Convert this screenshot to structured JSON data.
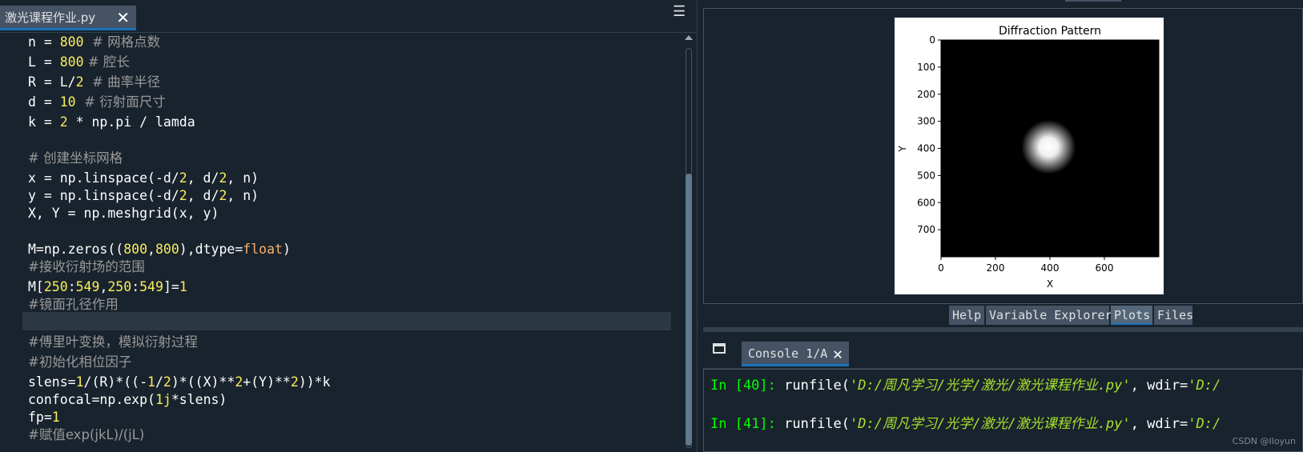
{
  "editor": {
    "tab_label": "激光课程作业.py",
    "close_glyph": "✕",
    "menu_glyph": "☰",
    "lines": [
      [
        {
          "t": "n = ",
          "c": ""
        },
        {
          "t": "800",
          "c": "num"
        },
        {
          "t": "  # ",
          "c": "cmt"
        },
        {
          "t": "网格点数",
          "c": "cmt"
        }
      ],
      [
        {
          "t": "L = ",
          "c": ""
        },
        {
          "t": "800",
          "c": "num"
        },
        {
          "t": " # ",
          "c": "cmt"
        },
        {
          "t": "腔长",
          "c": "cmt"
        }
      ],
      [
        {
          "t": "R = L/",
          "c": ""
        },
        {
          "t": "2",
          "c": "num"
        },
        {
          "t": "  # ",
          "c": "cmt"
        },
        {
          "t": "曲率半径",
          "c": "cmt"
        }
      ],
      [
        {
          "t": "d = ",
          "c": ""
        },
        {
          "t": "10",
          "c": "num"
        },
        {
          "t": "  # ",
          "c": "cmt"
        },
        {
          "t": "衍射面尺寸",
          "c": "cmt"
        }
      ],
      [
        {
          "t": "k = ",
          "c": ""
        },
        {
          "t": "2",
          "c": "num"
        },
        {
          "t": " * np.pi / lamda",
          "c": ""
        }
      ],
      [],
      [
        {
          "t": "# ",
          "c": "cmt"
        },
        {
          "t": "创建坐标网格",
          "c": "cmt"
        }
      ],
      [
        {
          "t": "x = np.linspace(-d/",
          "c": ""
        },
        {
          "t": "2",
          "c": "num"
        },
        {
          "t": ", d/",
          "c": ""
        },
        {
          "t": "2",
          "c": "num"
        },
        {
          "t": ", n)",
          "c": ""
        }
      ],
      [
        {
          "t": "y = np.linspace(-d/",
          "c": ""
        },
        {
          "t": "2",
          "c": "num"
        },
        {
          "t": ", d/",
          "c": ""
        },
        {
          "t": "2",
          "c": "num"
        },
        {
          "t": ", n)",
          "c": ""
        }
      ],
      [
        {
          "t": "X, Y = np.meshgrid(x, y)",
          "c": ""
        }
      ],
      [],
      [
        {
          "t": "M=np.zeros((",
          "c": ""
        },
        {
          "t": "800",
          "c": "num"
        },
        {
          "t": ",",
          "c": ""
        },
        {
          "t": "800",
          "c": "num"
        },
        {
          "t": "),dtype=",
          "c": ""
        },
        {
          "t": "float",
          "c": "kw"
        },
        {
          "t": ")",
          "c": ""
        }
      ],
      [
        {
          "t": "#",
          "c": "cmt"
        },
        {
          "t": "接收衍射场的范围",
          "c": "cmt"
        }
      ],
      [
        {
          "t": "M[",
          "c": ""
        },
        {
          "t": "250",
          "c": "num"
        },
        {
          "t": ":",
          "c": ""
        },
        {
          "t": "549",
          "c": "num"
        },
        {
          "t": ",",
          "c": ""
        },
        {
          "t": "250",
          "c": "num"
        },
        {
          "t": ":",
          "c": ""
        },
        {
          "t": "549",
          "c": "num"
        },
        {
          "t": "]=",
          "c": ""
        },
        {
          "t": "1",
          "c": "num"
        }
      ],
      [
        {
          "t": "#",
          "c": "cmt"
        },
        {
          "t": "镜面孔径作用",
          "c": "cmt"
        }
      ],
      [],
      [
        {
          "t": "#",
          "c": "cmt"
        },
        {
          "t": "傅里叶变换，模拟衍射过程",
          "c": "cmt"
        }
      ],
      [
        {
          "t": "#",
          "c": "cmt"
        },
        {
          "t": "初始化相位因子",
          "c": "cmt"
        }
      ],
      [
        {
          "t": "slens=",
          "c": ""
        },
        {
          "t": "1",
          "c": "num"
        },
        {
          "t": "/(R)*((-",
          "c": ""
        },
        {
          "t": "1",
          "c": "num"
        },
        {
          "t": "/",
          "c": ""
        },
        {
          "t": "2",
          "c": "num"
        },
        {
          "t": ")*((X)**",
          "c": ""
        },
        {
          "t": "2",
          "c": "num"
        },
        {
          "t": "+(Y)**",
          "c": ""
        },
        {
          "t": "2",
          "c": "num"
        },
        {
          "t": "))*k",
          "c": ""
        }
      ],
      [
        {
          "t": "confocal=np.exp(",
          "c": ""
        },
        {
          "t": "1j",
          "c": "num"
        },
        {
          "t": "*slens)",
          "c": ""
        }
      ],
      [
        {
          "t": "fp=",
          "c": ""
        },
        {
          "t": "1",
          "c": "num"
        }
      ],
      [
        {
          "t": "#赋值exp(jkL)/(jL)",
          "c": "cmt"
        }
      ]
    ]
  },
  "plot": {
    "title": "Diffraction Pattern",
    "xlabel": "X",
    "ylabel": "Y",
    "x_ticks": [
      "0",
      "200",
      "400",
      "600"
    ],
    "y_ticks": [
      "0",
      "100",
      "200",
      "300",
      "400",
      "500",
      "600",
      "700"
    ]
  },
  "chart_data": {
    "type": "heatmap",
    "title": "Diffraction Pattern",
    "xlabel": "X",
    "ylabel": "Y",
    "xlim": [
      0,
      800
    ],
    "ylim": [
      800,
      0
    ],
    "x_ticks": [
      0,
      200,
      400,
      600
    ],
    "y_ticks": [
      0,
      100,
      200,
      300,
      400,
      500,
      600,
      700
    ],
    "colormap": "gray",
    "bright_spot_center": [
      395,
      395
    ],
    "bright_spot_radius": 100
  },
  "plots_tabs": [
    "Help",
    "Variable Explorer",
    "Plots",
    "Files"
  ],
  "plots_active_tab": "Plots",
  "console": {
    "tab_label": "Console 1/A",
    "close_glyph": "✕",
    "lines": [
      {
        "prompt": "In [40]:",
        "code": " runfile(",
        "path": "'D:/周凡学习/光学/激光/激光课程作业.py'",
        "rest": ", wdir=",
        "wdir": "'D:/"
      },
      {
        "prompt": "In [41]:",
        "code": " runfile(",
        "path": "'D:/周凡学习/光学/激光/激光课程作业.py'",
        "rest": ", wdir=",
        "wdir": "'D:/"
      }
    ],
    "watermark": "CSDN @Iloyun"
  },
  "colors": {
    "background": "#19232d",
    "number": "#faed5c",
    "comment": "#999999",
    "keyword": "#fab16c",
    "prompt": "#00ff00",
    "string": "#a6e22e",
    "tab_accent": "#1a72bb"
  }
}
